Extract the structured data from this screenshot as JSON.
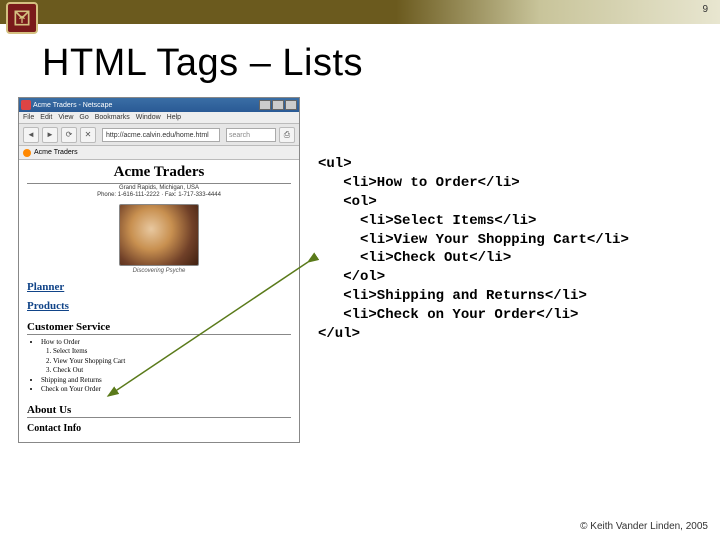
{
  "page_number": "9",
  "slide_title": "HTML Tags – Lists",
  "mock": {
    "window_title": "Acme Traders - Netscape",
    "menus": [
      "File",
      "Edit",
      "View",
      "Go",
      "Bookmarks",
      "Window",
      "Help"
    ],
    "url": "http://acme.calvin.edu/home.html",
    "search_placeholder": "search",
    "tab_label": "Acme Traders",
    "site_title": "Acme Traders",
    "site_sub": "Grand Rapids, Michigan, USA",
    "site_phone": "Phone: 1-616-111-2222   ·   Fax: 1-717-333-4444",
    "caption": "Discovering Psyche",
    "nav": {
      "planner": "Planner",
      "products": "Products",
      "cs_heading": "Customer Service",
      "about": "About Us",
      "contact": "Contact Info"
    },
    "cs_items": {
      "howto": "How to Order",
      "select": "Select Items",
      "view": "View Your Shopping Cart",
      "checkout": "Check Out",
      "shipping": "Shipping and Returns",
      "checkon": "Check on Your Order"
    }
  },
  "code": {
    "l1": "<ul>",
    "l2": "   <li>How to Order</li>",
    "l3": "   <ol>",
    "l4": "     <li>Select Items</li>",
    "l5": "     <li>View Your Shopping Cart</li>",
    "l6": "     <li>Check Out</li>",
    "l7": "   </ol>",
    "l8": "   <li>Shipping and Returns</li>",
    "l9": "   <li>Check on Your Order</li>",
    "l10": "</ul>"
  },
  "footer": "© Keith Vander Linden, 2005"
}
